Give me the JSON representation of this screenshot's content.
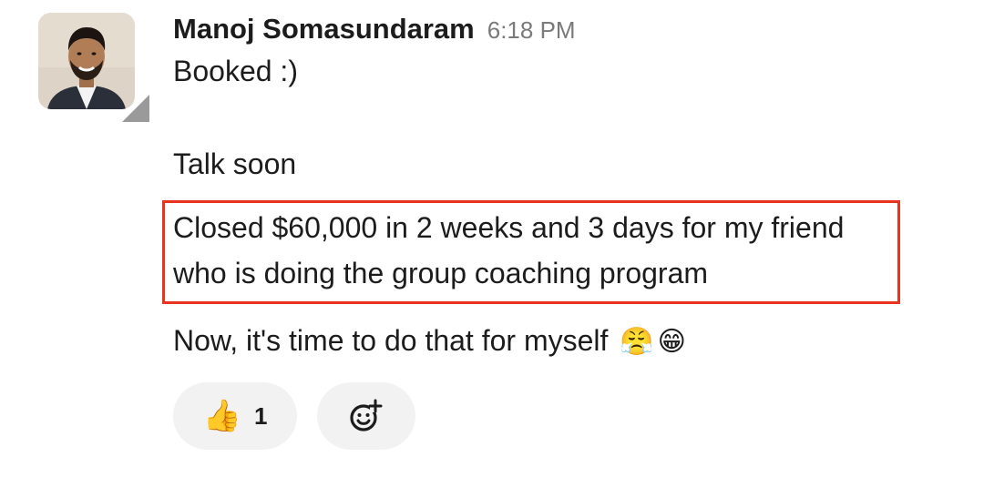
{
  "message": {
    "author": "Manoj Somasundaram",
    "timestamp": "6:18 PM",
    "lines": [
      "Booked :)",
      "Talk soon",
      "Closed $60,000 in 2 weeks and 3 days for my friend",
      "who is doing the group coaching program",
      "Now, it's time to do that for myself"
    ],
    "trailing_emojis": [
      "😤",
      "😁"
    ]
  },
  "reactions": [
    {
      "emoji": "👍",
      "icon": "thumbs-up-icon",
      "count": "1"
    }
  ],
  "add_reaction": {
    "icon": "add-emoji-icon"
  },
  "colors": {
    "highlight_border": "#e8331e",
    "reaction_bg": "#f2f2f2",
    "timestamp": "#7a7a7a",
    "presence": "#9a9a9a"
  }
}
